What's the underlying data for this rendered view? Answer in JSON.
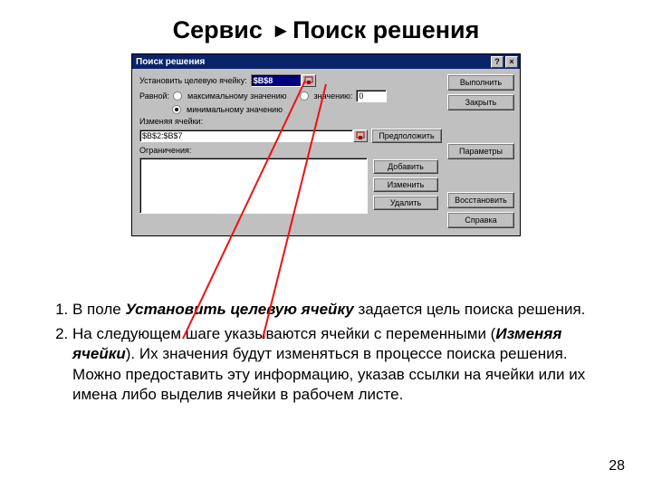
{
  "title": {
    "left": "Сервис",
    "right": "Поиск решения"
  },
  "dlg": {
    "caption": "Поиск решения",
    "targetLabel": "Установить целевую ячейку:",
    "targetValue": "$B$8",
    "equalLabel": "Равной:",
    "radioMax": "максимальному значению",
    "radioVal": "значению:",
    "valInput": "0",
    "radioMin": "минимальному значению",
    "changingLabel": "Изменяя ячейки:",
    "changingValue": "$B$2:$B$7",
    "constraintsLabel": "Ограничения:",
    "buttons": {
      "run": "Выполнить",
      "close": "Закрыть",
      "guess": "Предположить",
      "params": "Параметры",
      "reset": "Восстановить",
      "help": "Справка",
      "add": "Добавить",
      "change": "Изменить",
      "del": "Удалить"
    }
  },
  "body": {
    "item1a": "В поле ",
    "item1b": "Установить целевую ячейку",
    "item1c": " задается цель поиска решения.",
    "item2a": "На следующем шаге указываются  ячейки с переменными (",
    "item2b": "Изменяя ячейки",
    "item2c": "). Их значения будут изменяться в процессе поиска решения. Можно предоставить эту информацию, указав ссылки на ячейки или их имена либо выделив ячейки в рабочем листе."
  },
  "pagenum": "28"
}
